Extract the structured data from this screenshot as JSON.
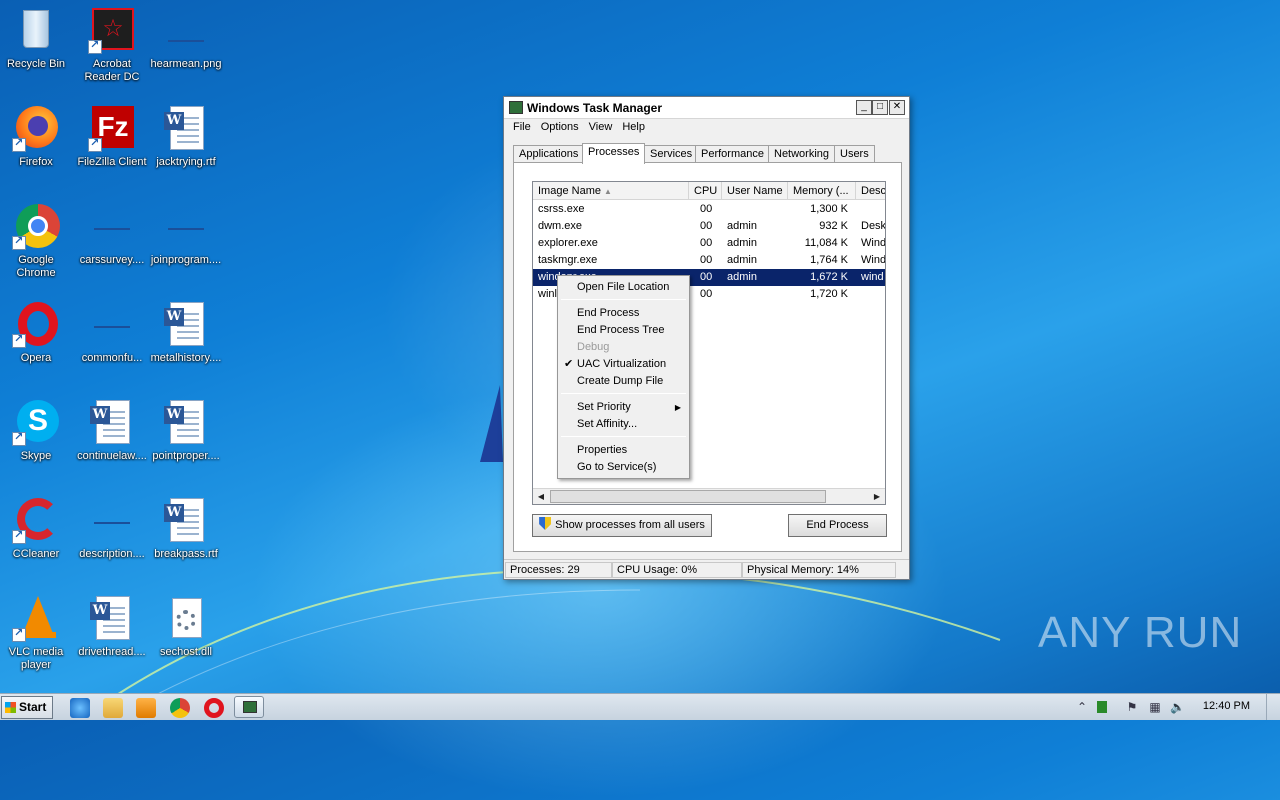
{
  "desktop": {
    "icons": [
      {
        "label": "Recycle Bin",
        "icon": "recycle-bin-icon"
      },
      {
        "label": "Acrobat Reader DC",
        "icon": "acrobat-icon"
      },
      {
        "label": "hearmean.png",
        "icon": "image-file-icon"
      },
      {
        "label": "Firefox",
        "icon": "firefox-icon"
      },
      {
        "label": "FileZilla Client",
        "icon": "filezilla-icon"
      },
      {
        "label": "jacktrying.rtf",
        "icon": "word-doc-icon"
      },
      {
        "label": "Google Chrome",
        "icon": "chrome-icon"
      },
      {
        "label": "carssurvey....",
        "icon": "blank-file-icon"
      },
      {
        "label": "joinprogram....",
        "icon": "blank-file-icon"
      },
      {
        "label": "Opera",
        "icon": "opera-icon"
      },
      {
        "label": "commonfu...",
        "icon": "blank-file-icon"
      },
      {
        "label": "metalhistory....",
        "icon": "word-doc-icon"
      },
      {
        "label": "Skype",
        "icon": "skype-icon"
      },
      {
        "label": "continuelaw....",
        "icon": "word-doc-icon"
      },
      {
        "label": "pointproper....",
        "icon": "word-doc-icon"
      },
      {
        "label": "CCleaner",
        "icon": "ccleaner-icon"
      },
      {
        "label": "description....",
        "icon": "blank-file-icon"
      },
      {
        "label": "breakpass.rtf",
        "icon": "word-doc-icon"
      },
      {
        "label": "VLC media player",
        "icon": "vlc-icon"
      },
      {
        "label": "drivethread....",
        "icon": "word-doc-icon"
      },
      {
        "label": "sechost.dll",
        "icon": "dll-file-icon"
      }
    ]
  },
  "taskmanager": {
    "title": "Windows Task Manager",
    "menu": [
      "File",
      "Options",
      "View",
      "Help"
    ],
    "tabs": [
      "Applications",
      "Processes",
      "Services",
      "Performance",
      "Networking",
      "Users"
    ],
    "active_tab": "Processes",
    "columns": [
      "Image Name",
      "CPU",
      "User Name",
      "Memory (...",
      "Desc"
    ],
    "rows": [
      {
        "name": "csrss.exe",
        "cpu": "00",
        "user": "",
        "memory": "1,300 K",
        "desc": ""
      },
      {
        "name": "dwm.exe",
        "cpu": "00",
        "user": "admin",
        "memory": "932 K",
        "desc": "Desk"
      },
      {
        "name": "explorer.exe",
        "cpu": "00",
        "user": "admin",
        "memory": "11,084 K",
        "desc": "Wind"
      },
      {
        "name": "taskmgr.exe",
        "cpu": "00",
        "user": "admin",
        "memory": "1,764 K",
        "desc": "Wind"
      },
      {
        "name": "windapr.exe",
        "cpu": "00",
        "user": "admin",
        "memory": "1,672 K",
        "desc": "wind"
      },
      {
        "name": "winlo",
        "cpu": "00",
        "user": "",
        "memory": "1,720 K",
        "desc": ""
      }
    ],
    "selected_row": 4,
    "show_all_button": "Show processes from all users",
    "end_process_button": "End Process",
    "status": {
      "processes": "Processes: 29",
      "cpu": "CPU Usage: 0%",
      "memory": "Physical Memory: 14%"
    }
  },
  "context_menu": {
    "items": [
      {
        "label": "Open File Location",
        "disabled": false
      },
      {
        "label": "End Process",
        "disabled": false
      },
      {
        "label": "End Process Tree",
        "disabled": false
      },
      {
        "label": "Debug",
        "disabled": true
      },
      {
        "label": "UAC Virtualization",
        "disabled": false,
        "checked": true
      },
      {
        "label": "Create Dump File",
        "disabled": false
      },
      {
        "label": "Set Priority",
        "disabled": false,
        "submenu": true
      },
      {
        "label": "Set Affinity...",
        "disabled": false
      },
      {
        "label": "Properties",
        "disabled": false
      },
      {
        "label": "Go to Service(s)",
        "disabled": false
      }
    ]
  },
  "taskbar": {
    "start_label": "Start",
    "pinned": [
      "ie-icon",
      "explorer-folder-icon",
      "media-player-icon",
      "chrome-icon",
      "opera-icon",
      "task-manager-icon"
    ],
    "clock": "12:40 PM"
  },
  "watermark": "ANY RUN"
}
